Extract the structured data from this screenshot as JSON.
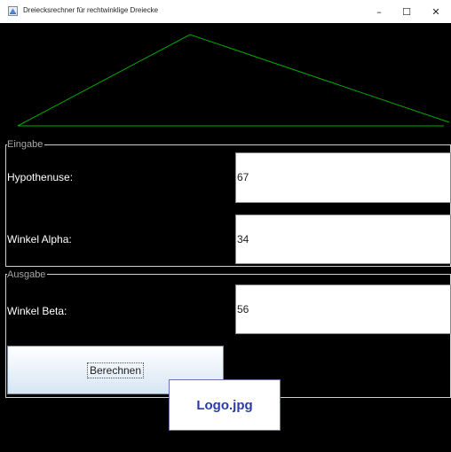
{
  "window": {
    "title": "Dreiecksrechner für rechtwinklige Dreiecke",
    "minimize": "–",
    "maximize": "☐",
    "close": "✕"
  },
  "colors": {
    "triangle_stroke": "#00aa00",
    "background": "#000000"
  },
  "eingabe": {
    "legend": "Eingabe",
    "hypotenuse_label": "Hypothenuse:",
    "hypotenuse_value": "67",
    "alpha_label": "Winkel Alpha:",
    "alpha_value": "34"
  },
  "ausgabe": {
    "legend": "Ausgabe",
    "beta_label": "Winkel Beta:",
    "beta_value": "56"
  },
  "compute_button": "Berechnen",
  "logo": "Logo.jpg"
}
